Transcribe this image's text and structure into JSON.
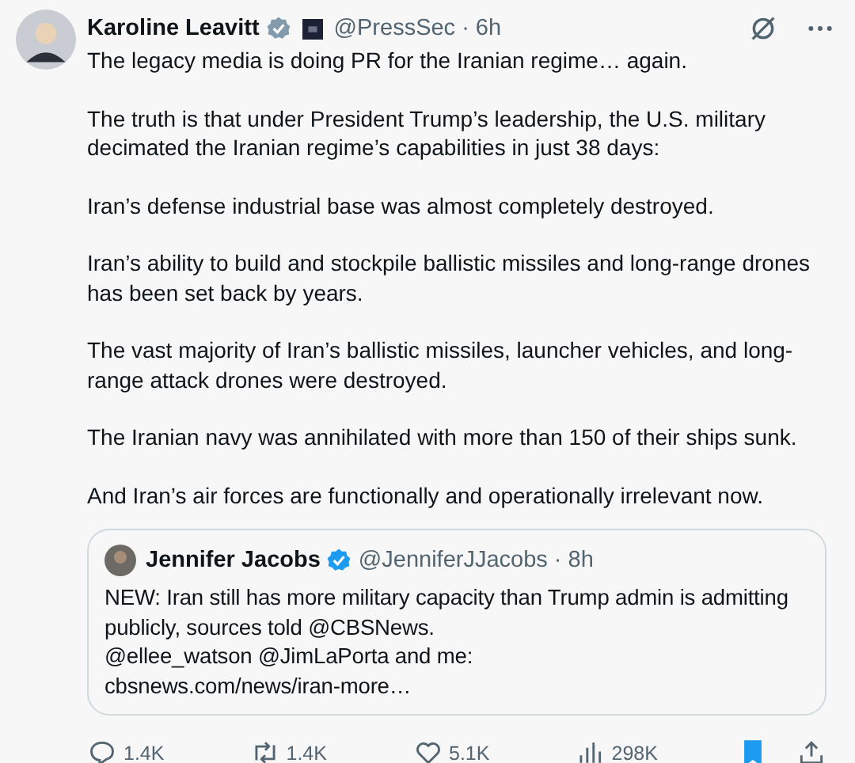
{
  "post": {
    "name": "Karoline Leavitt",
    "handle": "@PressSec",
    "time": "· 6h",
    "verified": true,
    "paragraphs": [
      "The legacy media is doing PR for the Iranian regime… again.",
      "The truth is that under President Trump’s leadership, the U.S. military decimated the Iranian regime’s capabilities in just 38 days:",
      "Iran’s defense industrial base was almost completely destroyed.",
      "Iran’s ability to build and stockpile ballistic missiles and long-range drones has been set back by years.",
      "The vast majority of Iran’s ballistic missiles, launcher vehicles, and long-range attack drones were destroyed.",
      "The Iranian navy was annihilated with more than 150 of their ships sunk.",
      "And Iran’s air forces are functionally and operationally irrelevant now."
    ]
  },
  "quote": {
    "name": "Jennifer Jacobs",
    "handle": "@JenniferJJacobs",
    "time": "· 8h",
    "verified": true,
    "lines": [
      "NEW: Iran still has more military capacity than Trump admin is admitting publicly, sources told @CBSNews.",
      "@ellee_watson @JimLaPorta and me:",
      "cbsnews.com/news/iran-more…"
    ]
  },
  "actions": {
    "replies": "1.4K",
    "reposts": "1.4K",
    "likes": "5.1K",
    "views": "298K",
    "bookmarked": true
  }
}
